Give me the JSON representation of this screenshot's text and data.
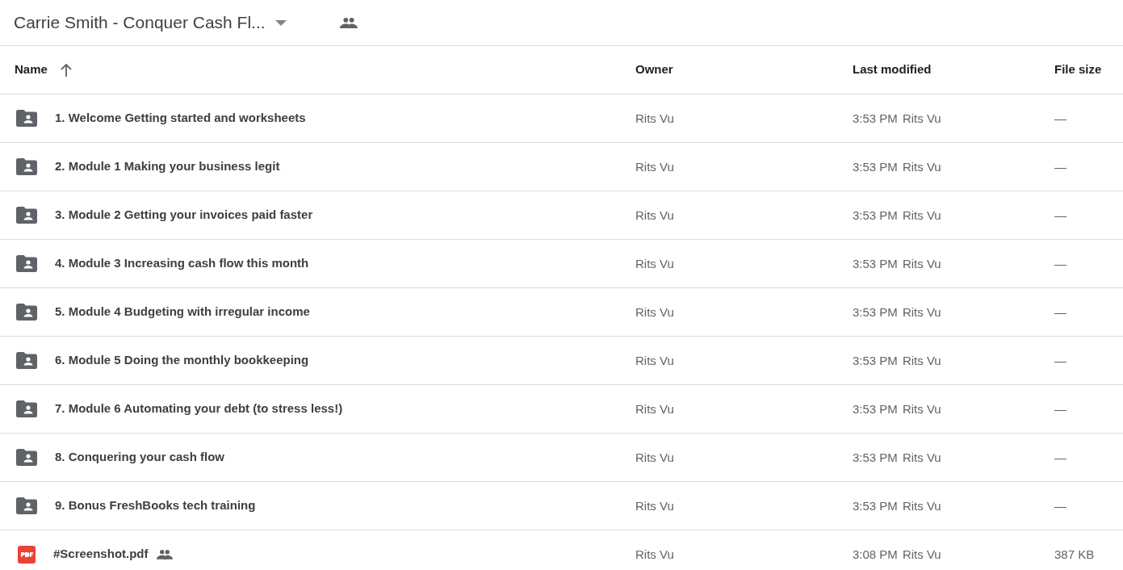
{
  "header": {
    "title": "Carrie Smith - Conquer Cash Fl...",
    "shared": true
  },
  "table": {
    "columns": [
      {
        "label": "Name",
        "sorted": true
      },
      {
        "label": "Owner",
        "sorted": false
      },
      {
        "label": "Last modified",
        "sorted": false
      },
      {
        "label": "File size",
        "sorted": false
      }
    ],
    "rows": [
      {
        "kind": "folder",
        "name": "1. Welcome Getting started and worksheets",
        "shared": false,
        "owner": "Rits Vu",
        "time": "3:53 PM",
        "modified_by": "Rits Vu",
        "size": "—"
      },
      {
        "kind": "folder",
        "name": "2. Module 1 Making your business legit",
        "shared": false,
        "owner": "Rits Vu",
        "time": "3:53 PM",
        "modified_by": "Rits Vu",
        "size": "—"
      },
      {
        "kind": "folder",
        "name": "3. Module 2 Getting your invoices paid faster",
        "shared": false,
        "owner": "Rits Vu",
        "time": "3:53 PM",
        "modified_by": "Rits Vu",
        "size": "—"
      },
      {
        "kind": "folder",
        "name": "4. Module 3 Increasing cash flow this month",
        "shared": false,
        "owner": "Rits Vu",
        "time": "3:53 PM",
        "modified_by": "Rits Vu",
        "size": "—"
      },
      {
        "kind": "folder",
        "name": "5. Module 4 Budgeting with irregular income",
        "shared": false,
        "owner": "Rits Vu",
        "time": "3:53 PM",
        "modified_by": "Rits Vu",
        "size": "—"
      },
      {
        "kind": "folder",
        "name": "6. Module 5 Doing the monthly bookkeeping",
        "shared": false,
        "owner": "Rits Vu",
        "time": "3:53 PM",
        "modified_by": "Rits Vu",
        "size": "—"
      },
      {
        "kind": "folder",
        "name": "7. Module 6 Automating your debt (to stress less!)",
        "shared": false,
        "owner": "Rits Vu",
        "time": "3:53 PM",
        "modified_by": "Rits Vu",
        "size": "—"
      },
      {
        "kind": "folder",
        "name": "8. Conquering your cash flow",
        "shared": false,
        "owner": "Rits Vu",
        "time": "3:53 PM",
        "modified_by": "Rits Vu",
        "size": "—"
      },
      {
        "kind": "folder",
        "name": "9. Bonus FreshBooks tech training",
        "shared": false,
        "owner": "Rits Vu",
        "time": "3:53 PM",
        "modified_by": "Rits Vu",
        "size": "—"
      },
      {
        "kind": "pdf",
        "name": "#Screenshot.pdf",
        "shared": true,
        "owner": "Rits Vu",
        "time": "3:08 PM",
        "modified_by": "Rits Vu",
        "size": "387 KB"
      }
    ]
  }
}
